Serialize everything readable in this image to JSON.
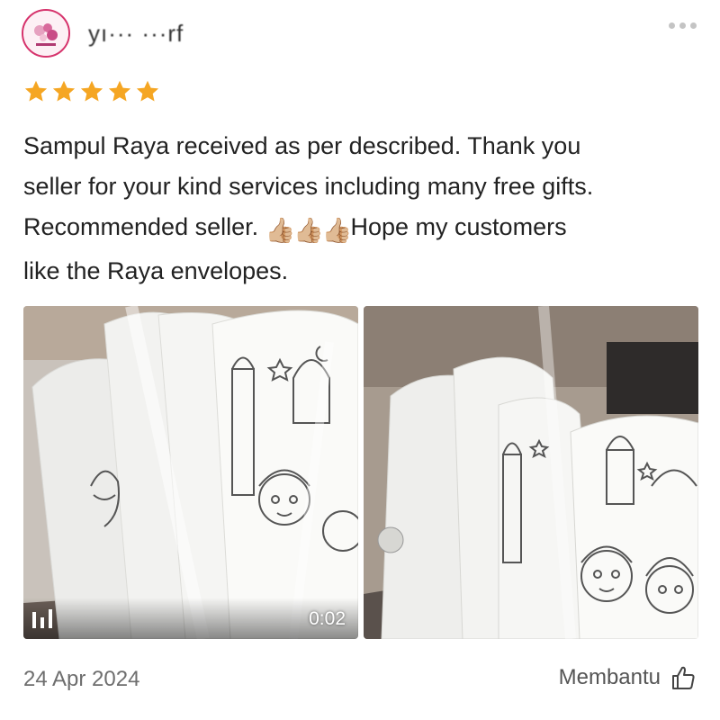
{
  "reviewer": {
    "name": "yı··· ···rf",
    "avatar_icon": "shop-logo-avatar"
  },
  "more_icon": "more-dots-icon",
  "rating": {
    "stars": 5,
    "max": 5,
    "color": "#f5a623"
  },
  "review": {
    "line1": "Sampul Raya received as per described. Thank you",
    "line2": "seller for your kind services including many free gifts.",
    "line3_before": "Recommended seller. ",
    "line3_emoji": "👍🏼👍🏼👍🏼",
    "line3_after": "Hope my customers",
    "line4": "like the Raya envelopes."
  },
  "media": [
    {
      "type": "video",
      "duration": "0:02",
      "icon": "video-bars-icon"
    },
    {
      "type": "photo"
    }
  ],
  "footer": {
    "date": "24 Apr 2024",
    "helpful_label": "Membantu",
    "helpful_icon": "thumbs-up-outline-icon"
  }
}
